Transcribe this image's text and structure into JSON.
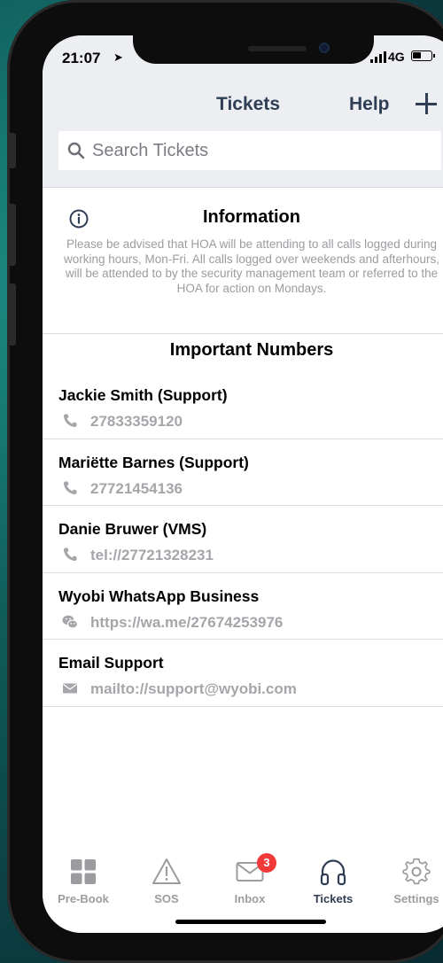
{
  "status": {
    "time": "21:07",
    "network": "4G"
  },
  "header": {
    "title": "Tickets",
    "help": "Help"
  },
  "search": {
    "placeholder": "Search Tickets"
  },
  "info": {
    "title": "Information",
    "text": "Please be advised that HOA will be attending to all calls logged during working hours, Mon-Fri. All calls  logged over weekends and afterhours, will be attended to by the security management team or referred to the HOA for action on Mondays."
  },
  "numbers": {
    "title": "Important Numbers",
    "contacts": [
      {
        "name": "Jackie Smith (Support)",
        "value": "27833359120",
        "icon": "phone-icon"
      },
      {
        "name": "Mariëtte Barnes (Support)",
        "value": "27721454136",
        "icon": "phone-icon"
      },
      {
        "name": "Danie Bruwer (VMS)",
        "value": "tel://27721328231",
        "icon": "phone-icon"
      },
      {
        "name": "Wyobi WhatsApp Business",
        "value": "https://wa.me/27674253976",
        "icon": "wechat-icon"
      },
      {
        "name": "Email Support",
        "value": "mailto://support@wyobi.com",
        "icon": "envelope-icon"
      }
    ]
  },
  "tabs": [
    {
      "label": "Pre-Book",
      "icon": "grid-icon"
    },
    {
      "label": "SOS",
      "icon": "warning-icon"
    },
    {
      "label": "Inbox",
      "icon": "mail-icon",
      "badge": "3"
    },
    {
      "label": "Tickets",
      "icon": "headphones-icon",
      "active": true
    },
    {
      "label": "Settings",
      "icon": "gear-icon"
    }
  ],
  "colors": {
    "accent": "#2f3e55",
    "badge": "#f03a3a",
    "header_bg": "#eceef1"
  }
}
